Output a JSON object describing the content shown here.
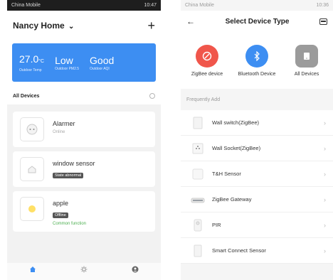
{
  "left": {
    "status": {
      "carrier": "China Mobile",
      "time": "10:47"
    },
    "header": {
      "title": "Nancy Home",
      "add_icon": "plus-icon"
    },
    "weather": {
      "items": [
        {
          "value": "27.0",
          "unit": "°C",
          "label": "Outdoor Temp"
        },
        {
          "value": "Low",
          "unit": "",
          "label": "Outdoor PM2.5"
        },
        {
          "value": "Good",
          "unit": "",
          "label": "Outdoor AQI"
        }
      ]
    },
    "tab": {
      "label": "All Devices"
    },
    "devices": [
      {
        "name": "Alarmer",
        "status": "Online"
      },
      {
        "name": "window sensor",
        "badge": "State abnormal"
      },
      {
        "name": "apple",
        "badge": "Offline",
        "extra": "Common function"
      }
    ],
    "nav": [
      "My Home",
      "Smart",
      "Profile"
    ],
    "colors": {
      "accent": "#3d8ef2",
      "green": "#4caf50"
    }
  },
  "right": {
    "status": {
      "carrier": "China Mobile",
      "time": "10:36"
    },
    "header": {
      "title": "Select Device Type"
    },
    "types": [
      {
        "label": "ZigBee device",
        "icon": "zigbee-icon",
        "color": "#f0564b"
      },
      {
        "label": "Bluetooth Device",
        "icon": "bluetooth-icon",
        "color": "#3d8ef2"
      },
      {
        "label": "All Devices",
        "icon": "all-devices-icon",
        "color": "#9b9b9b"
      }
    ],
    "frequent": {
      "heading": "Frequently Add",
      "items": [
        "Wall switch(ZigBee)",
        "Wall Socket(ZigBee)",
        "T&H Sensor",
        "ZigBee Gateway",
        "PIR",
        "Smart Connect Sensor"
      ]
    }
  }
}
